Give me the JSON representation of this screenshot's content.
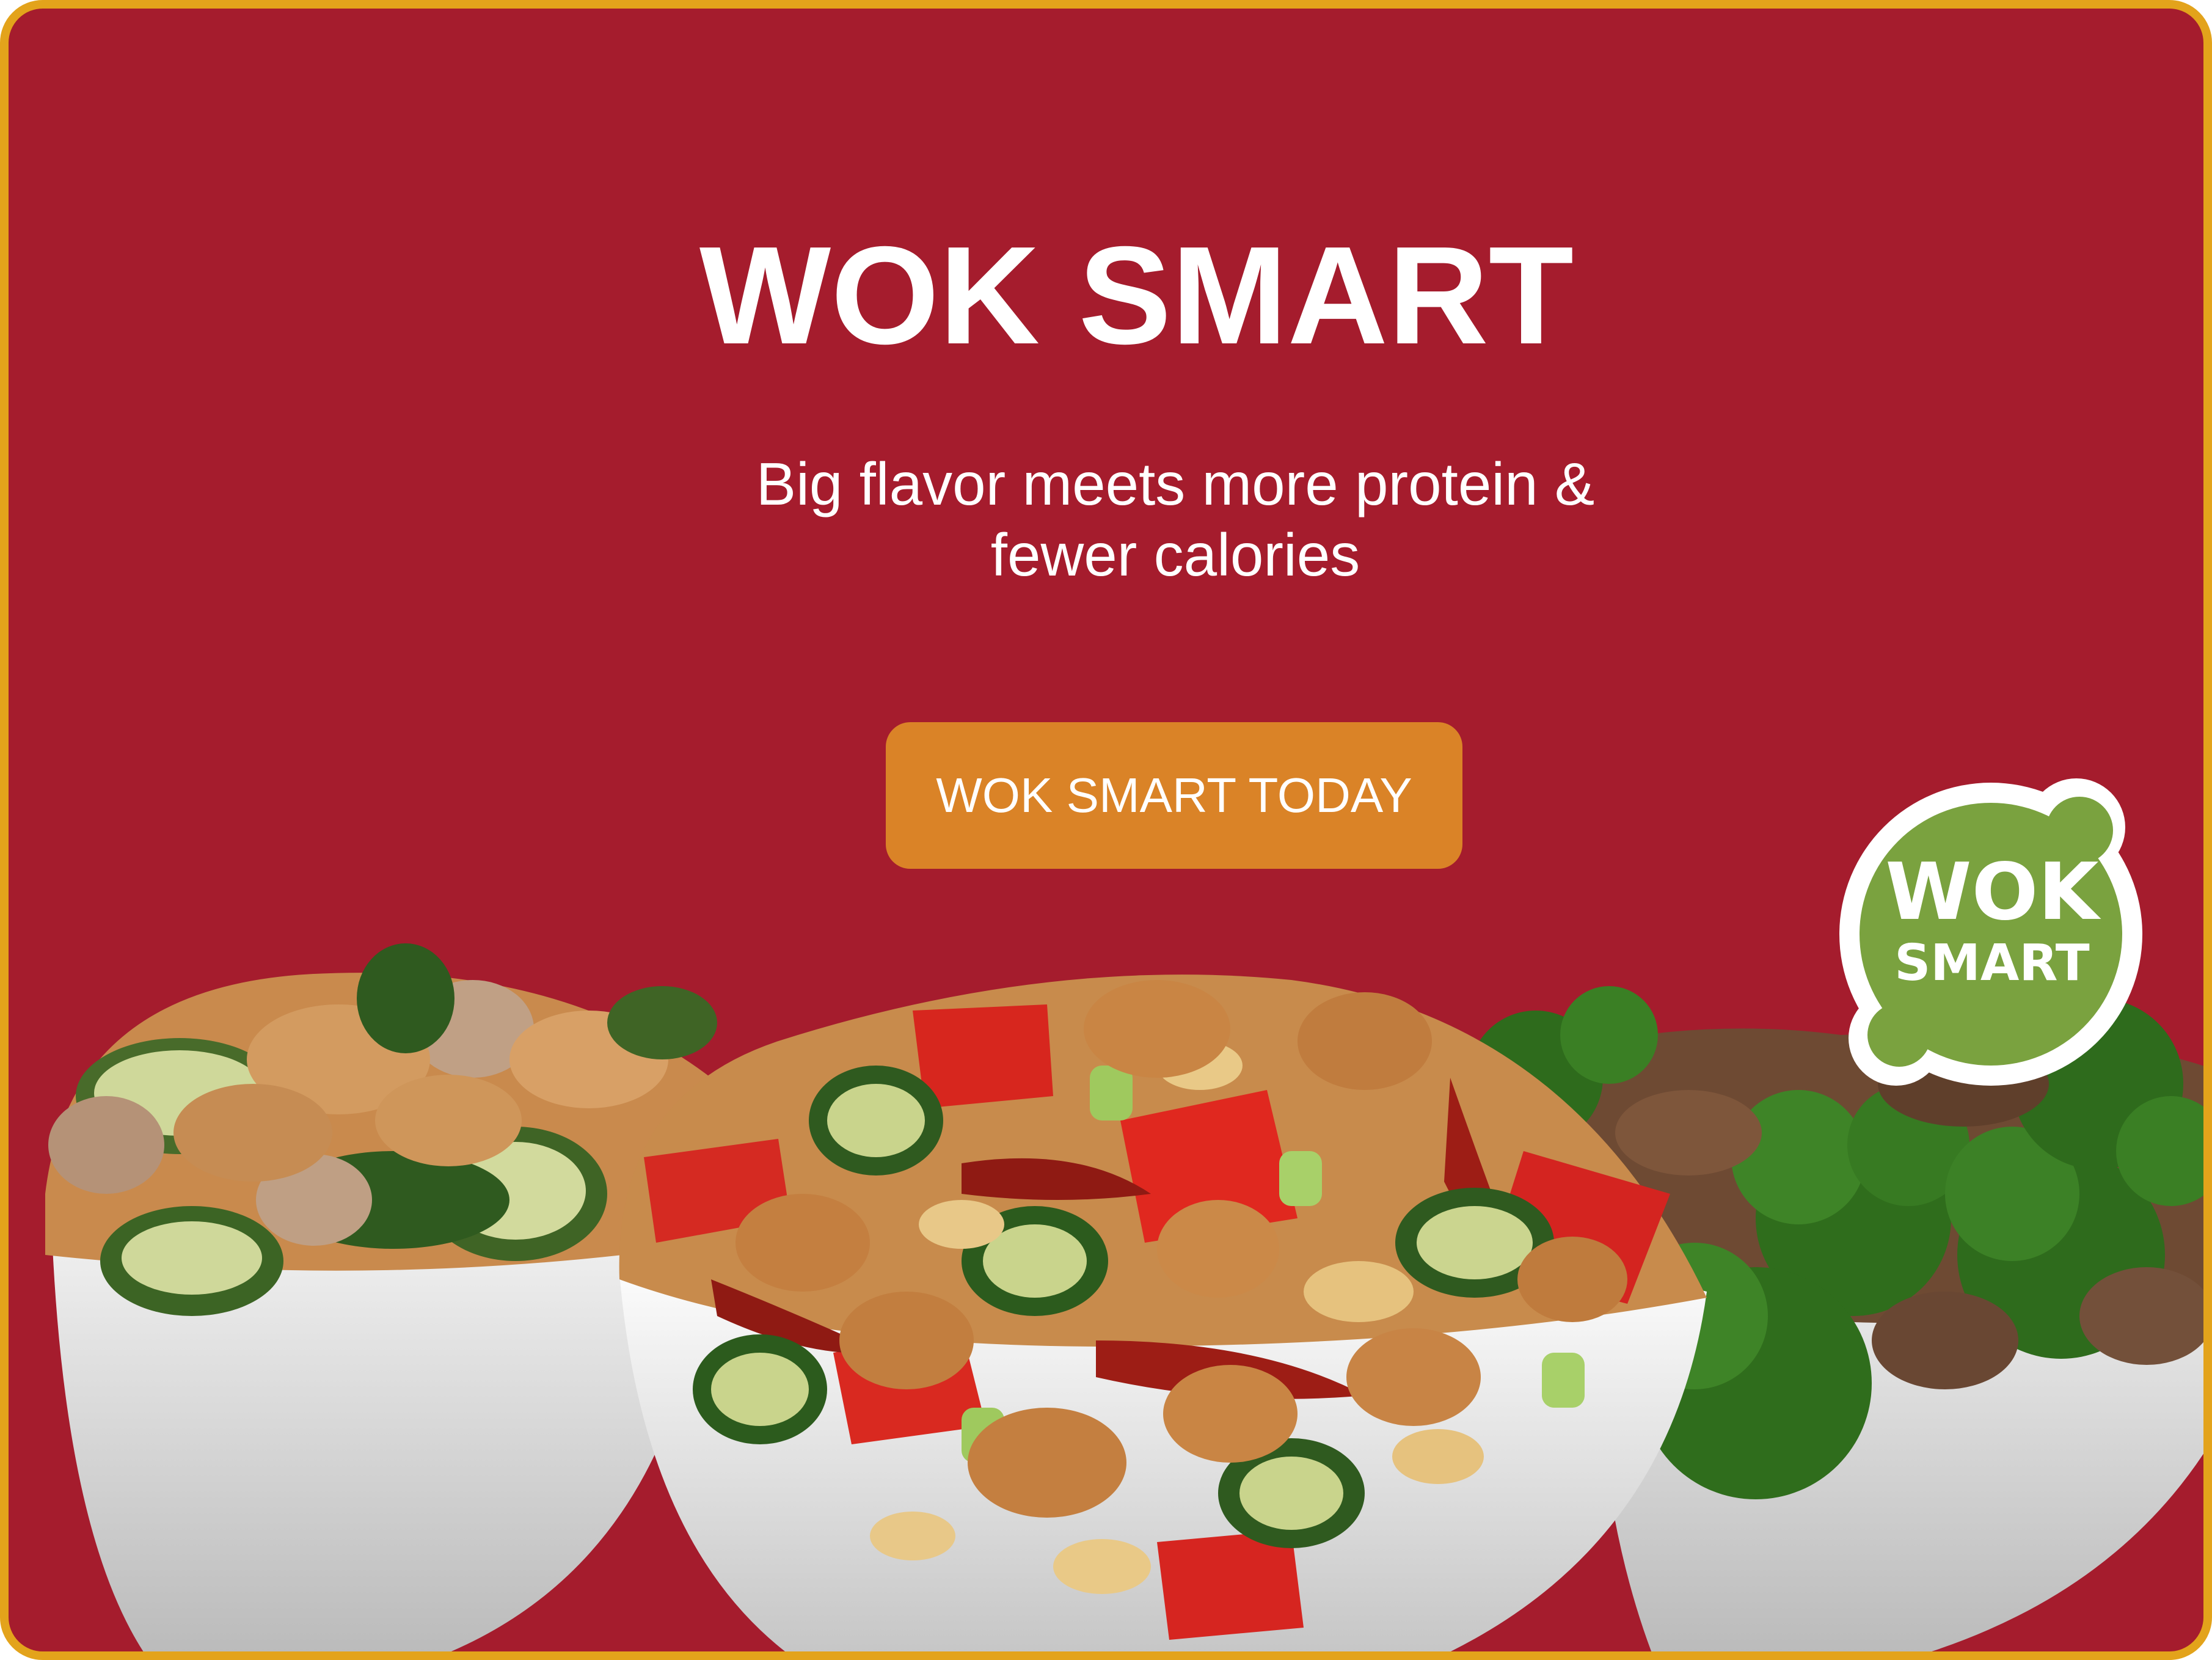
{
  "hero": {
    "title": "WOK SMART",
    "subtitle": "Big flavor meets more protein & fewer calories",
    "cta_label": "WOK SMART TODAY"
  },
  "badge": {
    "line1": "WOK",
    "line2": "SMART"
  },
  "colors": {
    "background": "#a51c2d",
    "border": "#e3a31b",
    "cta": "#da8327",
    "badge_green": "#7aa23f",
    "text": "#ffffff"
  },
  "images": {
    "food_bowls": "food-bowls-illustration"
  }
}
